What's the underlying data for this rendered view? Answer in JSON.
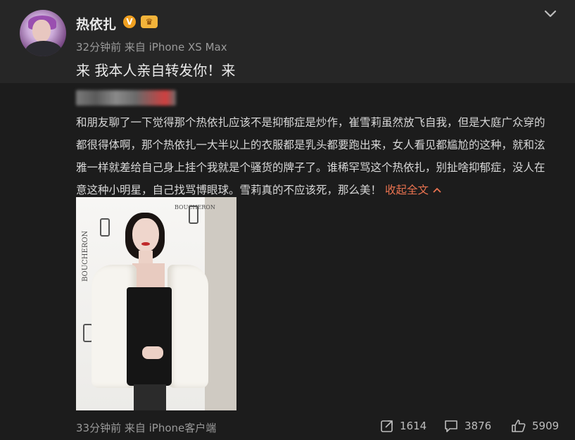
{
  "post": {
    "username": "热依扎",
    "verified_badge": "V",
    "time_source": "32分钟前 来自 iPhone XS Max",
    "text": "来 我本人亲自转发你！来"
  },
  "repost": {
    "body": "和朋友聊了一下觉得那个热依扎应该不是抑郁症是炒作，崔雪莉虽然放飞自我，但是大庭广众穿的都很得体啊，那个热依扎一大半以上的衣服都是乳头都要跑出来，女人看见都尴尬的这种，就和泫雅一样就差给自己身上挂个我就是个骚货的牌子了。谁稀罕骂这个热依扎，别扯啥抑郁症，没人在意这种小明星，自己找骂博眼球。雪莉真的不应该死，那么美！",
    "collapse_label": "收起全文",
    "photo_brand": "BOUCHERON",
    "time_source": "33分钟前 来自 iPhone客户端",
    "stats": {
      "reposts": "1614",
      "comments": "3876",
      "likes": "5909"
    }
  },
  "colors": {
    "accent": "#eb7350",
    "background": "#1c1c1c",
    "post_background": "#262626"
  },
  "icons": [
    "chevron-down-icon",
    "verified-icon",
    "crown-icon",
    "repost-icon",
    "comment-icon",
    "like-icon"
  ]
}
